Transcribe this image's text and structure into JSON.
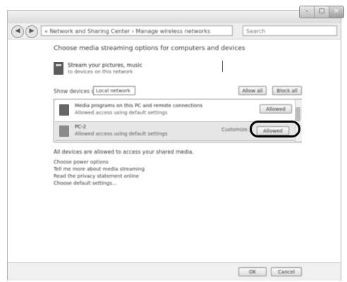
{
  "window": {
    "controls": {
      "minimize": "–",
      "maximize": "□",
      "close": "×"
    }
  },
  "address_bar": {
    "back_icon": "back-arrow-icon",
    "forward_icon": "forward-arrow-icon",
    "path": "« Network and Sharing Center › Manage wireless networks",
    "search_placeholder": "Search"
  },
  "main": {
    "heading": "Choose media streaming options for computers and devices",
    "library": {
      "title": "Stream your pictures, music",
      "subtitle": "to devices on this network"
    },
    "show_devices_label": "Show devices on:",
    "show_devices_value": "Local network",
    "allow_all_button": "Allow all",
    "block_all_button": "Block all",
    "devices": [
      {
        "name": "Media programs on this PC and remote connections",
        "detail": "Allowed access using default settings",
        "access": "Allowed"
      },
      {
        "name": "PC-2",
        "detail": "Allowed access using default settings",
        "status": "Customize...",
        "access": "Allowed"
      }
    ],
    "all_devices_note": "All devices are allowed to access your shared media.",
    "links": [
      "Choose power options",
      "Tell me more about media streaming",
      "Read the privacy statement online",
      "Choose default settings..."
    ]
  },
  "footer": {
    "ok_button": "OK",
    "cancel_button": "Cancel"
  }
}
